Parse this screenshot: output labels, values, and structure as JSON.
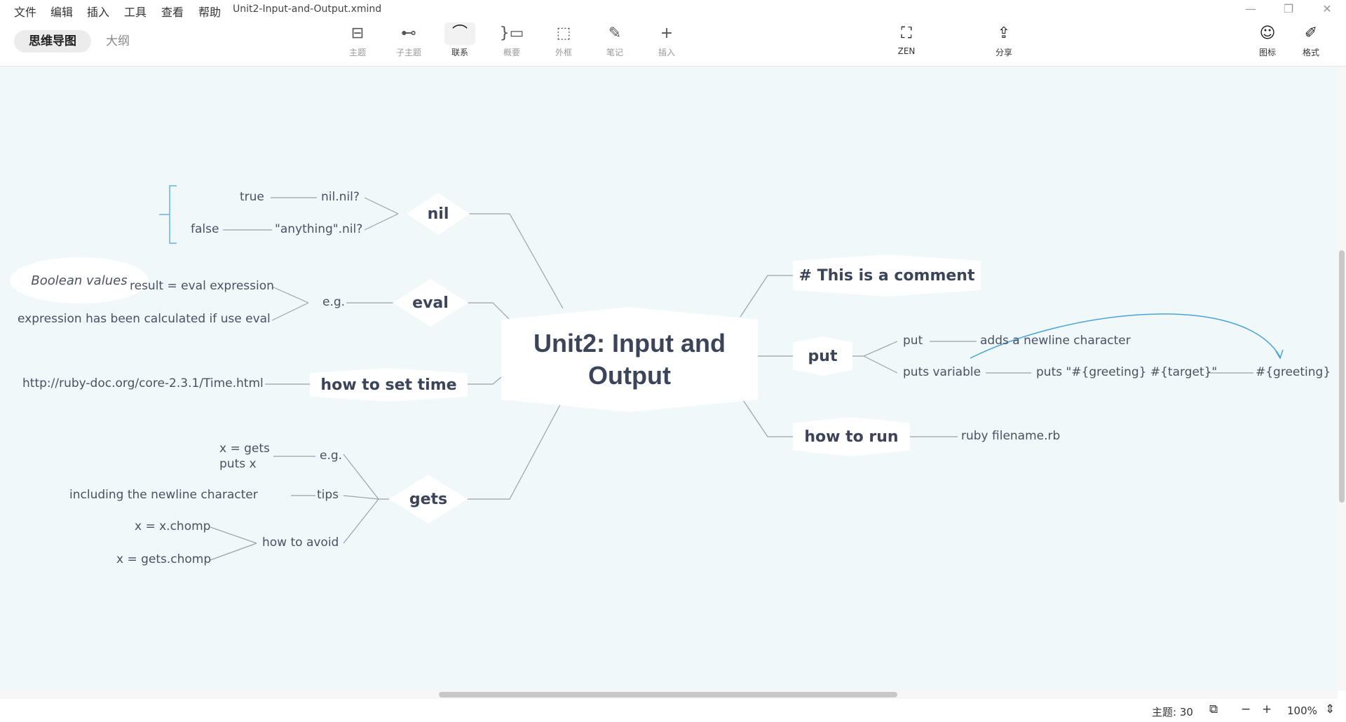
{
  "menu": {
    "items": [
      "文件",
      "编辑",
      "插入",
      "工具",
      "查看",
      "帮助"
    ],
    "filename": "Unit2-Input-and-Output.xmind"
  },
  "window": {
    "minimize": "—",
    "restore": "❐",
    "close": "✕"
  },
  "mode_tabs": {
    "mindmap": "思维导图",
    "outline": "大纲"
  },
  "toolbar": {
    "topic": {
      "label": "主题",
      "icon": "topic-icon",
      "glyph": "⊟"
    },
    "subtopic": {
      "label": "子主题",
      "icon": "subtopic-icon",
      "glyph": "⊷"
    },
    "relationship": {
      "label": "联系",
      "icon": "relationship-icon",
      "glyph": "⌒"
    },
    "summary": {
      "label": "概要",
      "icon": "summary-icon",
      "glyph": "}▭"
    },
    "boundary": {
      "label": "外框",
      "icon": "boundary-icon",
      "glyph": "⬚"
    },
    "notes": {
      "label": "笔记",
      "icon": "notes-icon",
      "glyph": "✎"
    },
    "insert": {
      "label": "插入",
      "icon": "plus-icon",
      "glyph": "+"
    },
    "zen": {
      "label": "ZEN",
      "icon": "zen-icon",
      "glyph": "⛶"
    },
    "share": {
      "label": "分享",
      "icon": "share-icon",
      "glyph": "⇪"
    },
    "icons_panel": {
      "label": "图标",
      "icon": "smiley-icon",
      "glyph": "☺"
    },
    "format_panel": {
      "label": "格式",
      "icon": "brush-icon",
      "glyph": "✐"
    }
  },
  "mindmap": {
    "central": {
      "line1": "Unit2: Input and",
      "line2": "Output"
    },
    "nil": {
      "title": "nil",
      "children": [
        "nil.nil?",
        "\"anything\".nil?"
      ],
      "grandchildren": [
        "true",
        "false"
      ],
      "summary": "Boolean values"
    },
    "eval": {
      "title": "eval",
      "child": "e.g.",
      "grandchildren": [
        "result = eval expression",
        "expression has been calculated if use eval"
      ]
    },
    "set_time": {
      "title": "how to set time",
      "child": "http://ruby-doc.org/core-2.3.1/Time.html"
    },
    "gets": {
      "title": "gets",
      "eg": {
        "label": "e.g.",
        "lines": [
          "x = gets",
          "puts x"
        ]
      },
      "tips": {
        "label": "tips",
        "child": "including the newline character"
      },
      "avoid": {
        "label": "how to avoid",
        "children": [
          "x = x.chomp",
          "x = gets.chomp"
        ]
      }
    },
    "comment": {
      "title": "# This is a comment"
    },
    "put": {
      "title": "put",
      "put_child": "put",
      "put_desc": "adds a newline character",
      "puts_var": "puts variable",
      "puts_code": "puts \"#{greeting} #{target}\"",
      "greeting": "#{greeting}"
    },
    "run": {
      "title": "how to run",
      "child": "ruby filename.rb"
    }
  },
  "status": {
    "topic_count": "主题: 30",
    "zoom": "100%",
    "zoom_out": "−",
    "zoom_in": "+"
  },
  "colors": {
    "canvas": "#f0f8f9",
    "connector": "#9aa2ac",
    "relationship": "#4aa3d9",
    "boundary": "#67b3db",
    "topic_text": "#3b4459"
  }
}
